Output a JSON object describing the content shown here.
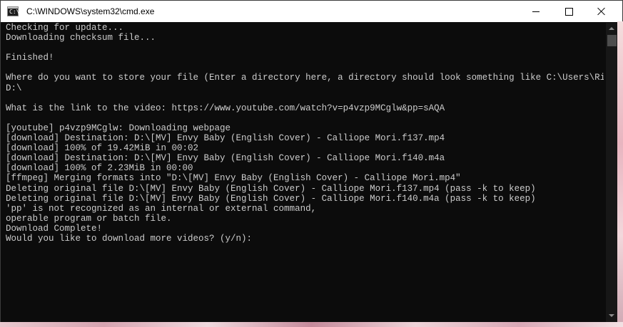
{
  "window": {
    "title": "C:\\WINDOWS\\system32\\cmd.exe",
    "icon": "cmd-console-icon",
    "icon_glyph": "C:\\"
  },
  "controls": {
    "minimize_icon": "minimize-icon",
    "maximize_icon": "maximize-icon",
    "close_icon": "close-icon"
  },
  "console": {
    "background": "#0c0c0c",
    "text_color": "#cccccc",
    "lines": [
      "Checking for update...",
      "Downloading checksum file...",
      "",
      "Finished!",
      "",
      "Where do you want to store your file (Enter a directory here, a directory should look something like C:\\Users\\Rick\\xxx):",
      "D:\\",
      "",
      "What is the link to the video: https://www.youtube.com/watch?v=p4vzp9MCglw&pp=sAQA",
      "",
      "[youtube] p4vzp9MCglw: Downloading webpage",
      "[download] Destination: D:\\[MV] Envy Baby (English Cover) - Calliope Mori.f137.mp4",
      "[download] 100% of 19.42MiB in 00:02",
      "[download] Destination: D:\\[MV] Envy Baby (English Cover) - Calliope Mori.f140.m4a",
      "[download] 100% of 2.23MiB in 00:00",
      "[ffmpeg] Merging formats into \"D:\\[MV] Envy Baby (English Cover) - Calliope Mori.mp4\"",
      "Deleting original file D:\\[MV] Envy Baby (English Cover) - Calliope Mori.f137.mp4 (pass -k to keep)",
      "Deleting original file D:\\[MV] Envy Baby (English Cover) - Calliope Mori.f140.m4a (pass -k to keep)",
      "'pp' is not recognized as an internal or external command,",
      "operable program or batch file.",
      "Download Complete!",
      "Would you like to download more videos? (y/n):"
    ]
  }
}
